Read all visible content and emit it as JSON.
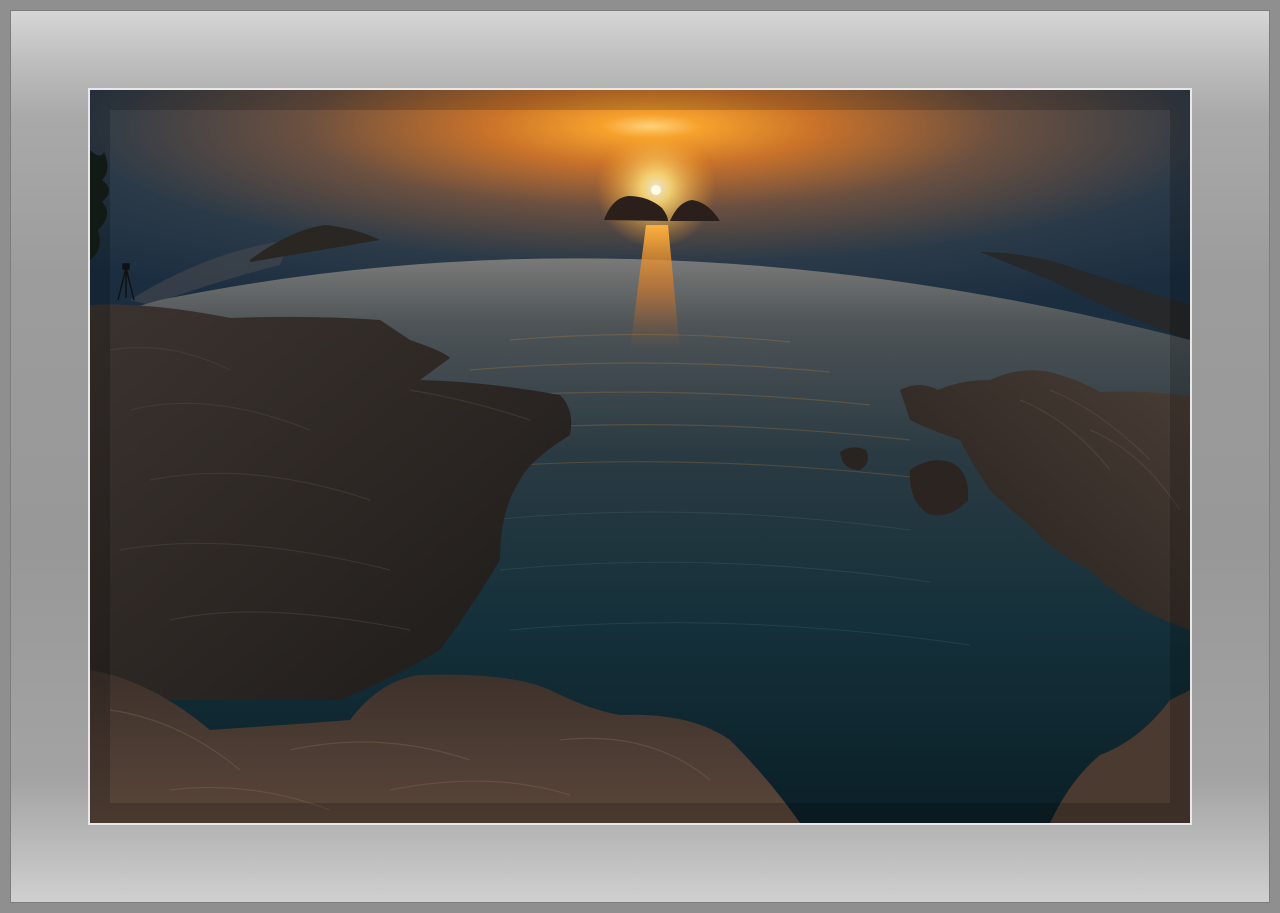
{
  "scene": {
    "subject": "photo-sunset-seascape",
    "colors": {
      "frame": "#8f8f8f",
      "mat_light": "#d6d6d6",
      "mat_dark": "#989898",
      "photo_border": "#e8e8e8",
      "sun": "#ffd27a",
      "sky_glow": "#f08a1e",
      "sky_top": "#1f3a4e",
      "water_dark": "#0f2530",
      "rock": "#3a2f2a"
    }
  }
}
